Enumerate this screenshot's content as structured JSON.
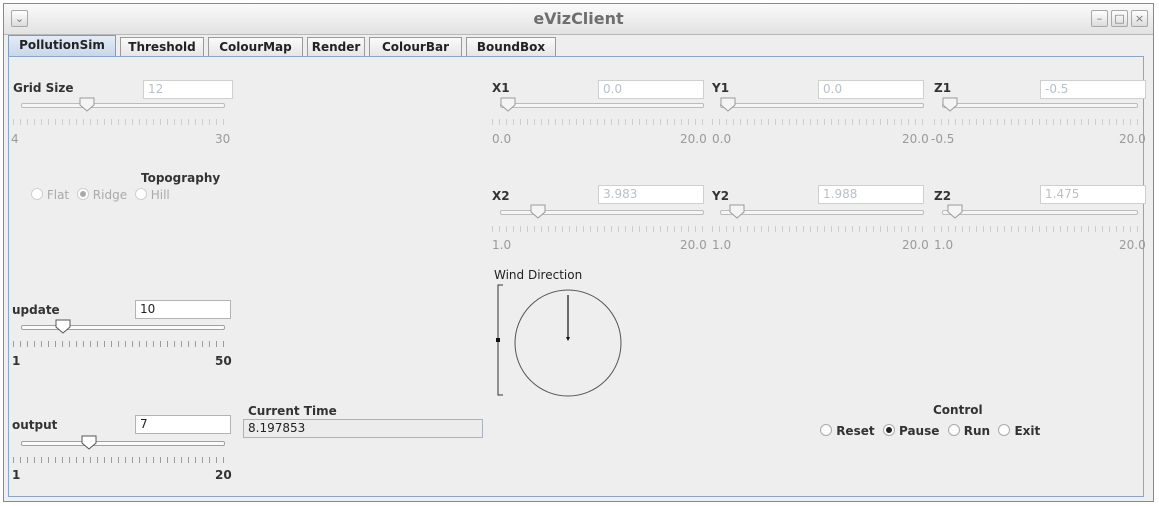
{
  "window": {
    "title": "eVizClient",
    "menu_icon": "chevron-down-icon",
    "buttons": [
      "minimize-icon",
      "maximize-icon",
      "close-icon"
    ]
  },
  "tabs": [
    {
      "label": "PollutionSim",
      "active": true
    },
    {
      "label": "Threshold",
      "active": false
    },
    {
      "label": "ColourMap",
      "active": false
    },
    {
      "label": "Render",
      "active": false
    },
    {
      "label": "ColourBar",
      "active": false
    },
    {
      "label": "BoundBox",
      "active": false
    }
  ],
  "grid_size": {
    "label": "Grid Size",
    "value": "12",
    "min": "4",
    "max": "30",
    "level": 0.31,
    "enabled": false
  },
  "topography": {
    "label": "Topography",
    "options": [
      "Flat",
      "Ridge",
      "Hill"
    ],
    "selected": "Ridge",
    "enabled": false
  },
  "update": {
    "label": "update",
    "value": "10",
    "min": "1",
    "max": "50",
    "level": 0.18,
    "enabled": true
  },
  "output": {
    "label": "output",
    "value": "7",
    "min": "1",
    "max": "20",
    "level": 0.32,
    "enabled": true
  },
  "current_time": {
    "label": "Current Time",
    "value": "8.197853"
  },
  "bounds": {
    "x1": {
      "label": "X1",
      "value": "0.0",
      "min": "0.0",
      "max": "20.0",
      "level": 0.0
    },
    "y1": {
      "label": "Y1",
      "value": "0.0",
      "min": "0.0",
      "max": "20.0",
      "level": 0.0
    },
    "z1": {
      "label": "Z1",
      "value": "-0.5",
      "min": "-0.5",
      "max": "20.0",
      "level": 0.0
    },
    "x2": {
      "label": "X2",
      "value": "3.983",
      "min": "1.0",
      "max": "20.0",
      "level": 0.16
    },
    "y2": {
      "label": "Y2",
      "value": "1.988",
      "min": "1.0",
      "max": "20.0",
      "level": 0.05
    },
    "z2": {
      "label": "Z2",
      "value": "1.475",
      "min": "1.0",
      "max": "20.0",
      "level": 0.03
    }
  },
  "wind": {
    "label": "Wind Direction",
    "direction_deg": 180,
    "elevation_level": 0.5
  },
  "control": {
    "label": "Control",
    "options": [
      "Reset",
      "Pause",
      "Run",
      "Exit"
    ],
    "selected": "Pause"
  }
}
